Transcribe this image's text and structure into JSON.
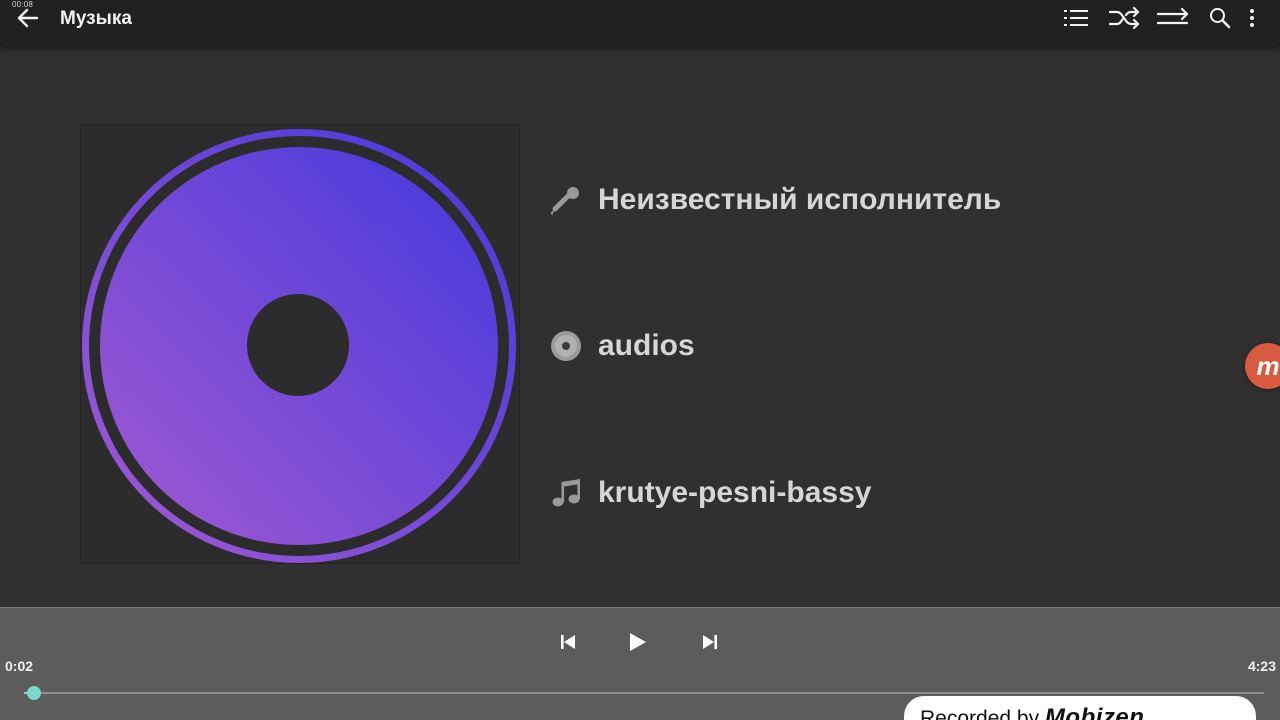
{
  "status_bar": {
    "time": "00:08"
  },
  "header": {
    "title": "Музыка",
    "actions": [
      "list-icon",
      "shuffle-icon",
      "repeat-icon",
      "search-icon",
      "more-vert-icon"
    ]
  },
  "track": {
    "artist": "Неизвестный исполнитель",
    "album": "audios",
    "title": "krutye-pesni-bassy"
  },
  "player": {
    "elapsed": "0:02",
    "duration": "4:23",
    "progress_percent": 0.8
  },
  "side_badge": {
    "letter": "m"
  },
  "watermark": {
    "prefix": "Recorded by",
    "brand": "Mobizen"
  },
  "colors": {
    "topbar": "#212121",
    "background": "#303030",
    "player_panel": "#5c5c5c",
    "accent": "#7fd6cc",
    "disc_start": "#9a5bd6",
    "disc_end": "#4a3ddc",
    "badge": "#d85a3f"
  }
}
